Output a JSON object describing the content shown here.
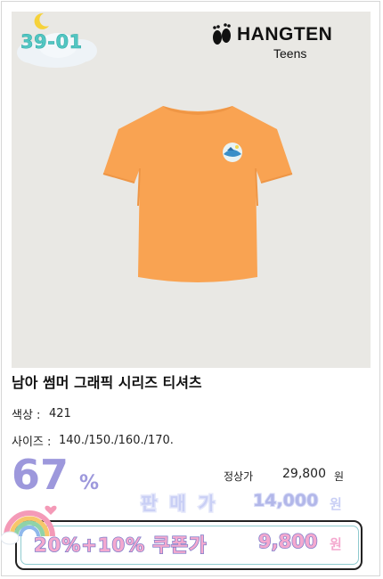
{
  "badge": {
    "code": "39-01"
  },
  "brand": {
    "name": "HANGTEN",
    "sub": "Teens"
  },
  "product": {
    "name": "남아 썸머 그래픽 시리즈 티셔츠",
    "color_label": "색상 :",
    "color_value": "421",
    "size_label": "사이즈 :",
    "size_value": "140./150./160./170."
  },
  "pricing": {
    "discount_value": "67",
    "discount_unit": "%",
    "regular_label": "정상가",
    "regular_price": "29,800",
    "regular_unit": "원",
    "sale_label": "판매가",
    "sale_price": "14,000",
    "sale_unit": "원",
    "coupon_label": "20%+10% 쿠폰가",
    "coupon_price": "9,800",
    "coupon_unit": "원"
  },
  "colors": {
    "tshirt": "#f9a352",
    "discount": "#9d98dc",
    "coupon_fill": "#f4a9cf",
    "code_teal": "#52c6c2"
  }
}
